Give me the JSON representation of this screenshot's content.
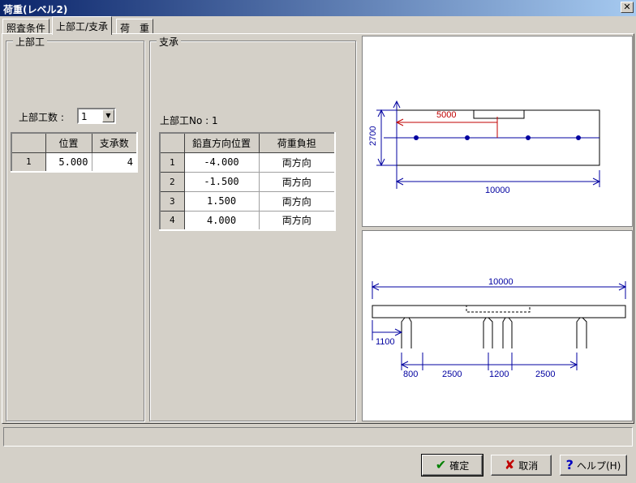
{
  "window": {
    "title": "荷重(レベル2)",
    "close_glyph": "✕"
  },
  "tabs": [
    {
      "label": "照査条件"
    },
    {
      "label": "上部工/支承"
    },
    {
      "label": "荷　重"
    }
  ],
  "superstructure": {
    "group_title": "上部工",
    "count_label": "上部工数 :",
    "count_value": "1",
    "table": {
      "headers": [
        "位置",
        "支承数"
      ],
      "rows": [
        {
          "no": "1",
          "position": "5.000",
          "bearings": "4"
        }
      ]
    }
  },
  "bearing": {
    "group_title": "支承",
    "selected_label": "上部工No : 1",
    "table": {
      "headers": [
        "鉛直方向位置",
        "荷重負担"
      ],
      "rows": [
        {
          "no": "1",
          "vertical": "-4.000",
          "load": "両方向"
        },
        {
          "no": "2",
          "vertical": "-1.500",
          "load": "両方向"
        },
        {
          "no": "3",
          "vertical": "1.500",
          "load": "両方向"
        },
        {
          "no": "4",
          "vertical": "4.000",
          "load": "両方向"
        }
      ]
    }
  },
  "plan_view": {
    "dim_5000": "5000",
    "dim_2700": "2700",
    "dim_10000": "10000"
  },
  "elevation_view": {
    "dim_top": "10000",
    "dim_1100": "1100",
    "dim_800": "800",
    "dim_2500a": "2500",
    "dim_1200": "1200",
    "dim_2500b": "2500"
  },
  "buttons": {
    "ok": {
      "label": "確定",
      "icon": "check-icon"
    },
    "cancel": {
      "label": "取消",
      "icon": "x-icon"
    },
    "help": {
      "label": "ヘルプ(H)",
      "icon": "question-icon"
    }
  },
  "colors": {
    "dim_blue": "#0000a0",
    "dim_red": "#c00000",
    "title_start": "#0a246a",
    "title_end": "#a6caf0"
  }
}
